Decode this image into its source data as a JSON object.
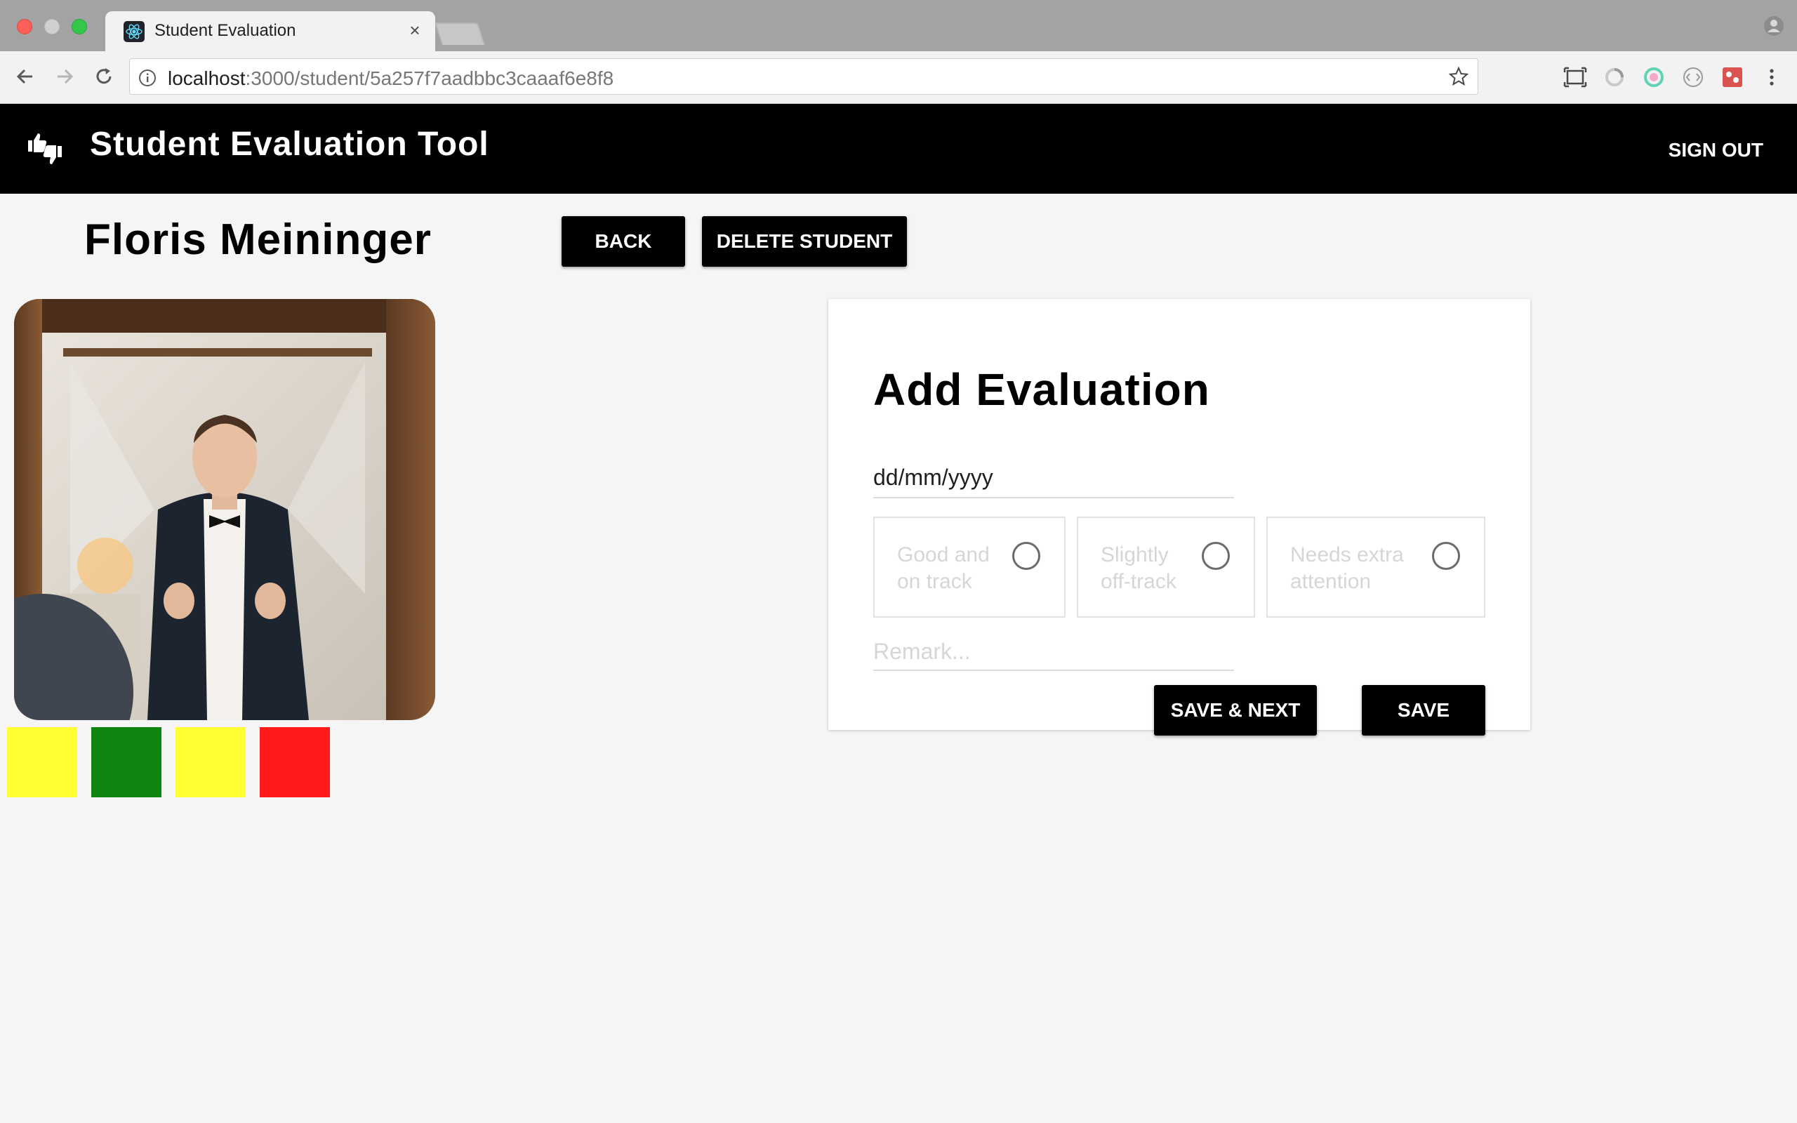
{
  "browser": {
    "tab_title": "Student Evaluation",
    "tab_close": "×",
    "url_host": "localhost",
    "url_path": ":3000/student/5a257f7aadbbc3caaaf6e8f8"
  },
  "header": {
    "title": "Student Evaluation Tool",
    "signout_label": "SIGN OUT",
    "logo_icon": "thumbs-up-down-icon"
  },
  "student": {
    "name": "Floris Meininger",
    "back_label": "BACK",
    "delete_label": "DELETE STUDENT",
    "evaluation_colors": [
      "#ffff33",
      "#0f840f",
      "#ffff33",
      "#ff1a1a"
    ]
  },
  "evaluation_form": {
    "title": "Add Evaluation",
    "date_placeholder": "dd/mm/yyyy",
    "options": [
      {
        "line1": "Good and",
        "line2": "on track"
      },
      {
        "line1": "Slightly",
        "line2": "off-track"
      },
      {
        "line1": "Needs extra",
        "line2": "attention"
      }
    ],
    "remark_placeholder": "Remark...",
    "save_next_label": "SAVE & NEXT",
    "save_label": "SAVE"
  }
}
